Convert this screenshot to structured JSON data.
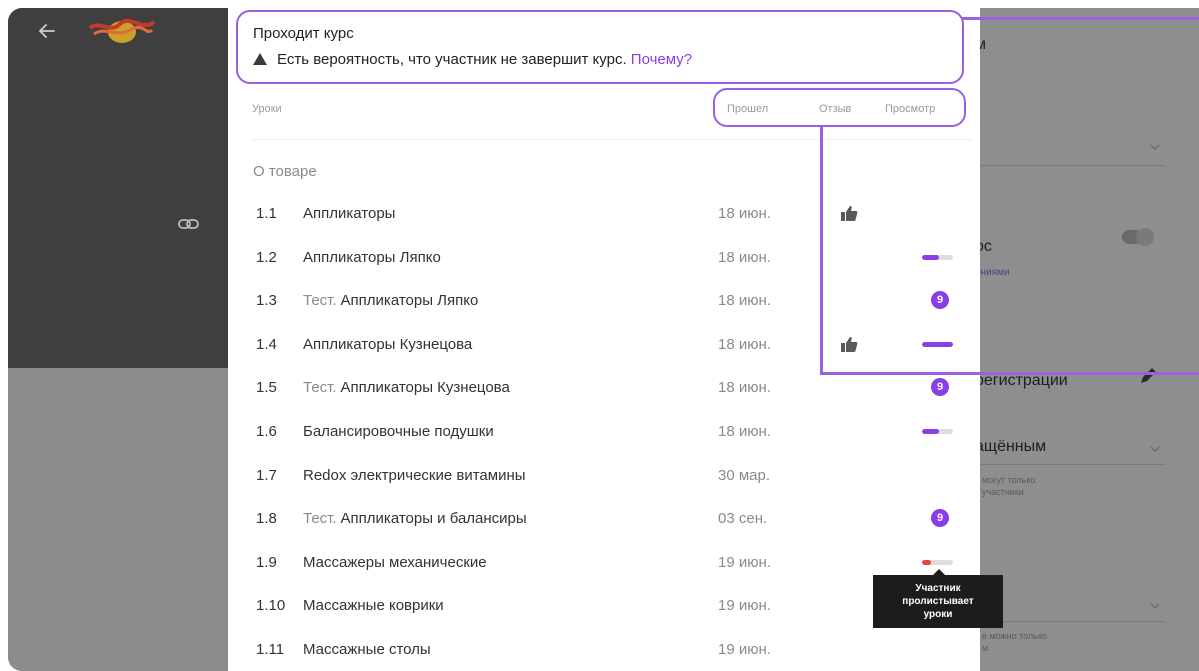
{
  "status": {
    "title": "Проходит курс",
    "warning_text": "Есть вероятность, что участник не завершит курс.",
    "warning_link": "Почему?"
  },
  "columns": {
    "lessons": "Уроки",
    "passed": "Прошел",
    "review": "Отзыв",
    "view": "Просмотр"
  },
  "section": {
    "title": "О товаре"
  },
  "lessons": [
    {
      "num": "1.1",
      "prefix": "",
      "title": "Аппликаторы",
      "date": "18 июн.",
      "thumb": true,
      "view": "none",
      "progress": 0
    },
    {
      "num": "1.2",
      "prefix": "",
      "title": "Аппликаторы Ляпко",
      "date": "18 июн.",
      "thumb": false,
      "view": "bar",
      "progress": 0.55
    },
    {
      "num": "1.3",
      "prefix": "Тест.",
      "title": "Аппликаторы Ляпко",
      "date": "18 июн.",
      "thumb": false,
      "view": "badge",
      "badge": "9"
    },
    {
      "num": "1.4",
      "prefix": "",
      "title": "Аппликаторы Кузнецова",
      "date": "18 июн.",
      "thumb": true,
      "view": "bar",
      "progress": 1.0
    },
    {
      "num": "1.5",
      "prefix": "Тест.",
      "title": "Аппликаторы Кузнецова",
      "date": "18 июн.",
      "thumb": false,
      "view": "badge",
      "badge": "9"
    },
    {
      "num": "1.6",
      "prefix": "",
      "title": "Балансировочные подушки",
      "date": "18 июн.",
      "thumb": false,
      "view": "bar",
      "progress": 0.55
    },
    {
      "num": "1.7",
      "prefix": "",
      "title": "Redox электрические витамины",
      "date": "30 мар.",
      "thumb": false,
      "view": "none",
      "progress": 0
    },
    {
      "num": "1.8",
      "prefix": "Тест.",
      "title": "Аппликаторы и балансиры",
      "date": "03 сен.",
      "thumb": false,
      "view": "badge",
      "badge": "9"
    },
    {
      "num": "1.9",
      "prefix": "",
      "title": "Массажеры механические",
      "date": "19 июн.",
      "thumb": false,
      "view": "bar-red",
      "progress": 0.3
    },
    {
      "num": "1.10",
      "prefix": "",
      "title": "Массажные коврики",
      "date": "19 июн.",
      "thumb": false,
      "view": "none",
      "progress": 0
    },
    {
      "num": "1.11",
      "prefix": "",
      "title": "Массажные столы",
      "date": "19 июн.",
      "thumb": false,
      "view": "none",
      "progress": 0
    }
  ],
  "tooltip": {
    "line1": "Участник",
    "line2": "пролистывает",
    "line3": "уроки"
  },
  "right_panel": {
    "t1": "м",
    "t2": "ос",
    "t2_sub": "ениями",
    "t3": "регистрации",
    "t4": "ащённым",
    "t4_note1": "могут только",
    "t4_note2": "участники",
    "t5_note1": "е можно только",
    "t5_note2": "м"
  },
  "colors": {
    "accent": "#8a3ee8",
    "callout": "#9b5fe3",
    "progress_red": "#e8453e"
  },
  "icons": {
    "back": "arrow-left-icon",
    "link": "link-icon",
    "warning": "warning-triangle-icon",
    "thumb": "thumbs-up-icon",
    "pencil": "pencil-icon"
  }
}
